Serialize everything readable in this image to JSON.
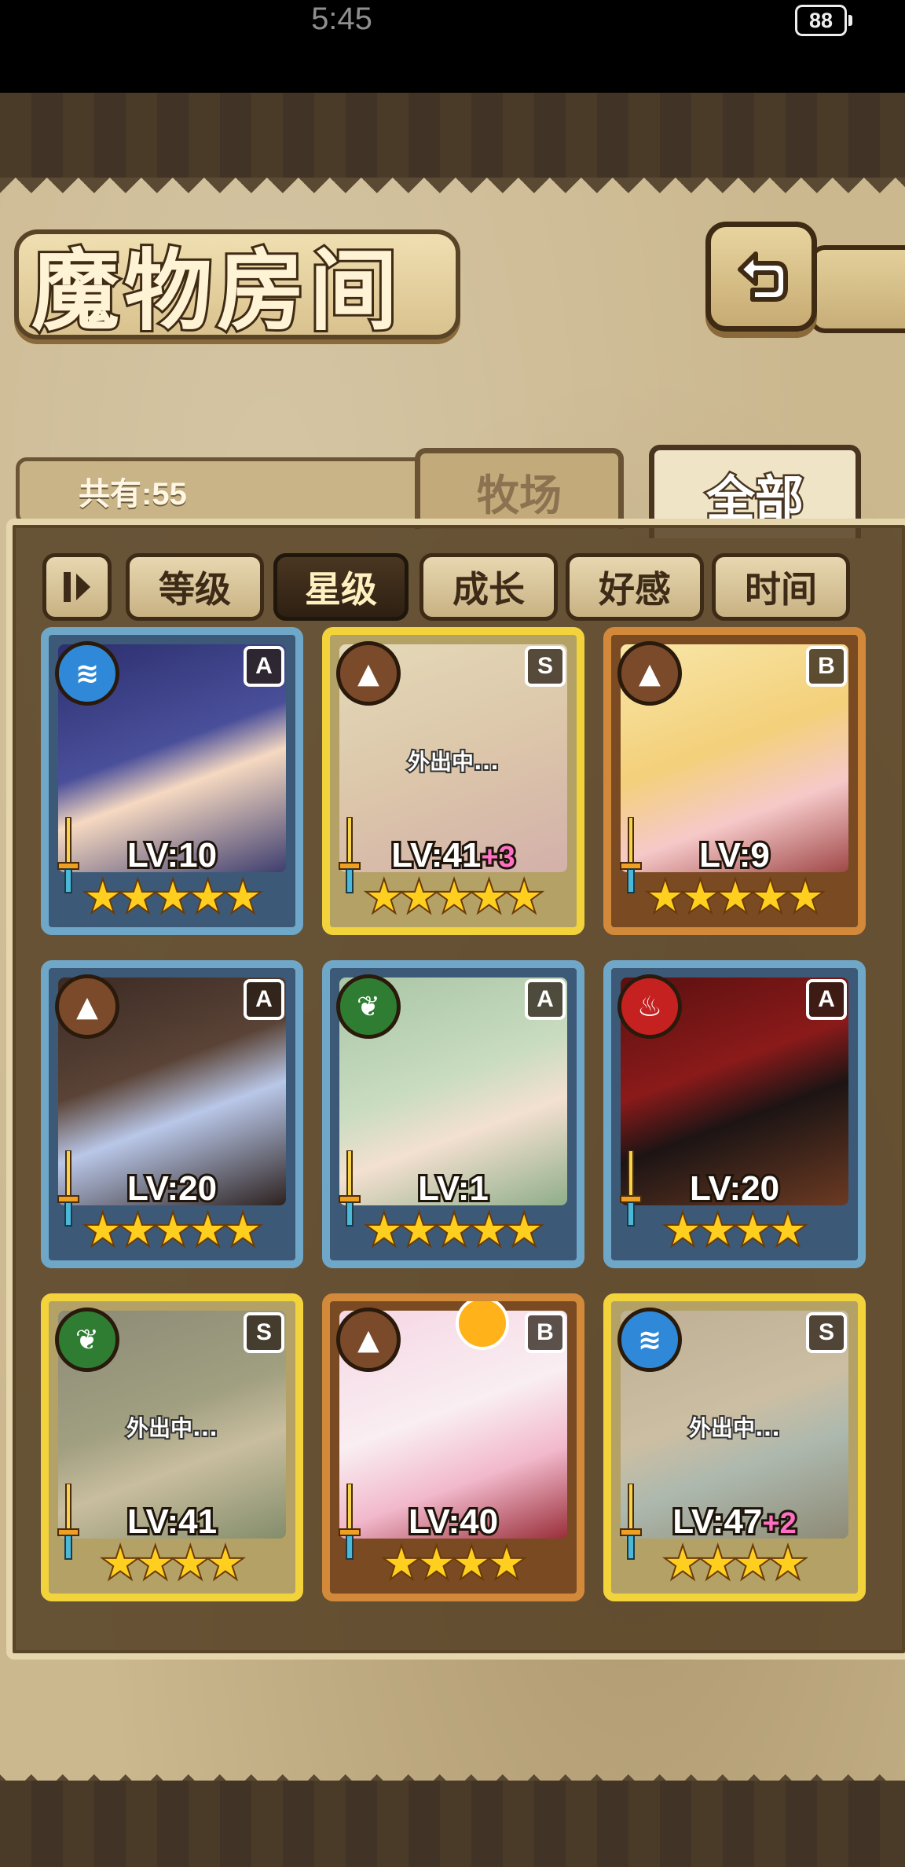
{
  "status_bar": {
    "time": "5:45",
    "battery": "88"
  },
  "header": {
    "title": "魔物房间"
  },
  "count": "共有:55",
  "tabs": [
    {
      "label": "牧场"
    },
    {
      "label": "全部"
    }
  ],
  "filters": [
    {
      "label": "等级",
      "active": false
    },
    {
      "label": "星级",
      "active": true
    },
    {
      "label": "成长",
      "active": false
    },
    {
      "label": "好感",
      "active": false
    },
    {
      "label": "时间",
      "active": false
    }
  ],
  "cards": [
    {
      "element": "water-icon",
      "rank": "A",
      "level": "LV:10",
      "plus": "",
      "stars": "★★★★★",
      "away": ""
    },
    {
      "element": "earth-icon",
      "rank": "S",
      "level": "LV:41",
      "plus": "+3",
      "stars": "★★★★★",
      "away": "外出中..."
    },
    {
      "element": "earth-icon",
      "rank": "B",
      "level": "LV:9",
      "plus": "",
      "stars": "★★★★★",
      "away": ""
    },
    {
      "element": "earth-icon",
      "rank": "A",
      "level": "LV:20",
      "plus": "",
      "stars": "★★★★★",
      "away": ""
    },
    {
      "element": "nature-icon",
      "rank": "A",
      "level": "LV:1",
      "plus": "",
      "stars": "★★★★★",
      "away": ""
    },
    {
      "element": "fire-icon",
      "rank": "A",
      "level": "LV:20",
      "plus": "",
      "stars": "★★★★",
      "away": ""
    },
    {
      "element": "nature-icon",
      "rank": "S",
      "level": "LV:41",
      "plus": "",
      "stars": "★★★★",
      "away": "外出中..."
    },
    {
      "element": "earth-icon",
      "rank": "B",
      "level": "LV:40",
      "plus": "",
      "stars": "★★★★",
      "away": ""
    },
    {
      "element": "water-icon",
      "rank": "S",
      "level": "LV:47",
      "plus": "+2",
      "stars": "★★★★",
      "away": "外出中..."
    }
  ],
  "colors": {
    "parchment": "#cbb88f",
    "frame_dark": "#3f2b14",
    "star": "#ffcf1f",
    "plus": "#ff6fc4"
  }
}
